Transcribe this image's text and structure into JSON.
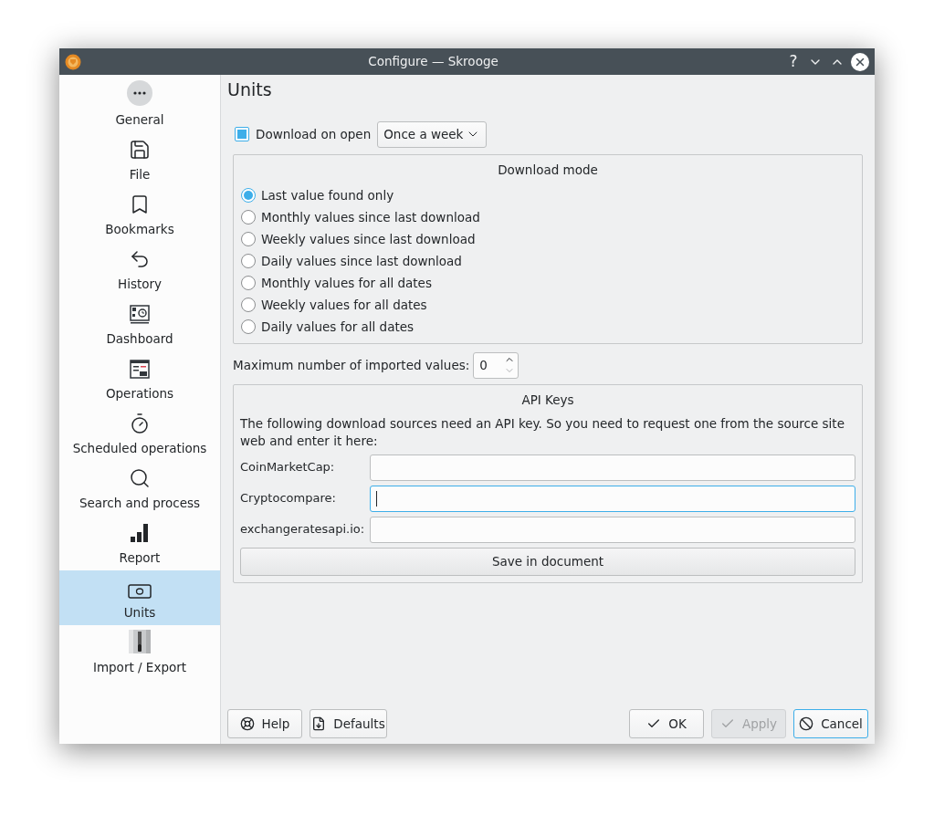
{
  "window": {
    "title": "Configure — Skrooge",
    "controls": [
      "?"
    ]
  },
  "sidebar": {
    "items": [
      {
        "label": "General",
        "selected": false
      },
      {
        "label": "File",
        "selected": false
      },
      {
        "label": "Bookmarks",
        "selected": false
      },
      {
        "label": "History",
        "selected": false
      },
      {
        "label": "Dashboard",
        "selected": false
      },
      {
        "label": "Operations",
        "selected": false
      },
      {
        "label": "Scheduled operations",
        "selected": false
      },
      {
        "label": "Search and process",
        "selected": false
      },
      {
        "label": "Report",
        "selected": false
      },
      {
        "label": "Units",
        "selected": true
      },
      {
        "label": "Import / Export",
        "selected": false
      }
    ]
  },
  "page": {
    "title": "Units",
    "download_on_open": {
      "label": "Download on open",
      "checked": true,
      "frequency": "Once a week"
    },
    "download_mode": {
      "title": "Download mode",
      "options": [
        {
          "label": "Last value found only",
          "selected": true
        },
        {
          "label": "Monthly values since last download",
          "selected": false
        },
        {
          "label": "Weekly values since last download",
          "selected": false
        },
        {
          "label": "Daily values since last download",
          "selected": false
        },
        {
          "label": "Monthly values for all dates",
          "selected": false
        },
        {
          "label": "Weekly values for all dates",
          "selected": false
        },
        {
          "label": "Daily values for all dates",
          "selected": false
        }
      ]
    },
    "max_values": {
      "label": "Maximum number of imported values:",
      "value": "0"
    },
    "api_keys": {
      "title": "API Keys",
      "description": "The following download sources need an API key. So you need to request one from the source site web and enter it here:",
      "fields": [
        {
          "label": "CoinMarketCap:",
          "focused": false
        },
        {
          "label": "Cryptocompare:",
          "focused": true
        },
        {
          "label": "exchangeratesapi.io:",
          "focused": false
        }
      ],
      "save_button": "Save in document"
    }
  },
  "buttons": [
    {
      "label": "Help",
      "kind": "help",
      "disabled": false,
      "focused": false
    },
    {
      "label": "Defaults",
      "kind": "defaults",
      "disabled": false,
      "focused": false
    },
    {
      "label": "OK",
      "kind": "ok",
      "disabled": false,
      "focused": false
    },
    {
      "label": "Apply",
      "kind": "apply",
      "disabled": true,
      "focused": false
    },
    {
      "label": "Cancel",
      "kind": "cancel",
      "disabled": false,
      "focused": true
    }
  ]
}
